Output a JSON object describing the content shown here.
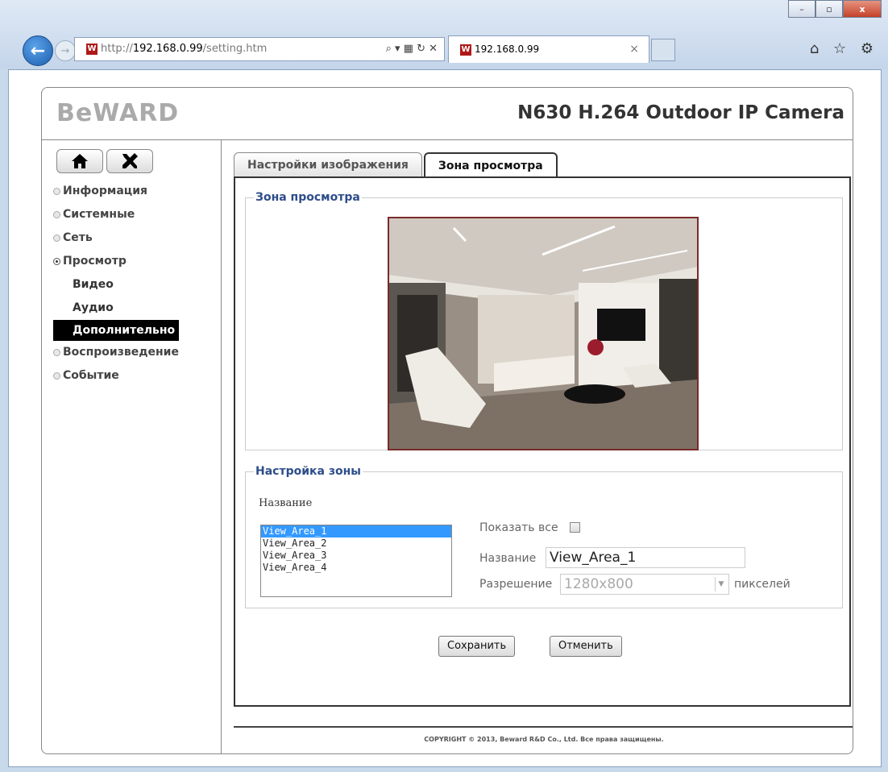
{
  "browser": {
    "window_buttons": [
      "–",
      "▫",
      "x"
    ],
    "back_icon": "←",
    "forward_icon": "→",
    "url_prefix": "http://",
    "url_host": "192.168.0.99",
    "url_path": "/setting.htm",
    "address_icons": "⌕ ▾ ▦ ↻ ✕",
    "tab_title": "192.168.0.99",
    "tab_close": "×",
    "toolbar_icons": "⌂ ☆ ⚙"
  },
  "header": {
    "logo": "BeWARD",
    "model": "N630 H.264 Outdoor IP Camera"
  },
  "sidebar": {
    "home_icon": "home-icon",
    "tools_icon": "tools-icon",
    "items": [
      {
        "label": "Информация",
        "expanded": false
      },
      {
        "label": "Системные",
        "expanded": false
      },
      {
        "label": "Сеть",
        "expanded": false
      },
      {
        "label": "Просмотр",
        "expanded": true
      },
      {
        "label": "Видео",
        "sub": true
      },
      {
        "label": "Аудио",
        "sub": true
      },
      {
        "label": "Дополнительно",
        "sub": true,
        "active": true
      },
      {
        "label": "Воспроизведение",
        "expanded": false
      },
      {
        "label": "Событие",
        "expanded": false
      }
    ]
  },
  "tabs": [
    {
      "label": "Настройки изображения",
      "active": false
    },
    {
      "label": "Зона просмотра",
      "active": true
    }
  ],
  "view_zone": {
    "legend": "Зона просмотра"
  },
  "zone_settings": {
    "legend": "Настройка зоны",
    "list_label": "Название",
    "areas": [
      "View_Area_1",
      "View_Area_2",
      "View_Area_3",
      "View_Area_4"
    ],
    "selected_index": 0,
    "show_all_label": "Показать все",
    "show_all_checked": false,
    "name_label": "Название",
    "name_value": "View_Area_1",
    "resolution_label": "Разрешение",
    "resolution_value": "1280x800",
    "resolution_unit": "пикселей"
  },
  "actions": {
    "save": "Сохранить",
    "cancel": "Отменить"
  },
  "footer": {
    "copyright": "COPYRIGHT © 2013, Beward R&D Co., Ltd. Все права защищены."
  }
}
